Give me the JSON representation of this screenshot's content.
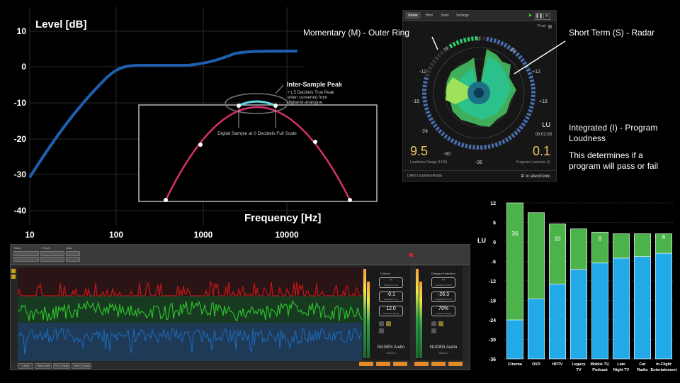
{
  "filter_chart": {
    "ylabel": "Level [dB]",
    "xlabel": "Frequency [Hz]",
    "yticks": [
      "10",
      "0",
      "-10",
      "-20",
      "-30",
      "-40"
    ],
    "xticks": [
      "10",
      "100",
      "1000",
      "10000"
    ],
    "isp_title": "Inter-Sample Peak",
    "isp_desc_1": "+1.5 Decibels True Peak",
    "isp_desc_2": "when converted from",
    "isp_desc_3": "digital to analogue.",
    "sample_label": "Digital Sample at 0 Decibels Full Scale",
    "curve_color": "#1f5fb0",
    "arc_color": "#d92f72",
    "peak_color": "#5fd8e6"
  },
  "radar": {
    "tabs": [
      "Radar",
      "Hmx",
      "Stats",
      "Settings"
    ],
    "peak_label": "Peak",
    "ticks": [
      "0",
      "+6",
      "+12",
      "+18",
      "-6",
      "-12",
      "-18",
      "-24",
      "-30",
      "-36"
    ],
    "lra_value": "9.5",
    "lra_label": "Loudness Range (LRA)",
    "lu_label": "LU",
    "time": "00:01:03",
    "program_value": "0.1",
    "program_label": "Program Loudness (I)",
    "product": "LM6n LoudnessRadar",
    "brand": "tc electronic",
    "value_color": "#e8c660"
  },
  "annotations": {
    "momentary": "Momentary (M) - Outer Ring",
    "short_term": "Short Term (S) - Radar",
    "integrated_1": "Integrated (I) - Program",
    "integrated_2": "Loudness",
    "determines_1": "This determines if a",
    "determines_2": "program will pass or fail"
  },
  "app": {
    "top_labels": [
      "Track",
      "Preset",
      "Data"
    ],
    "left_meter": {
      "title": "Custom",
      "box1_value": "--",
      "box1_caption": "Shortterm (LU)",
      "box2_value": "-0.1",
      "box2_caption": "Integrated (LU)",
      "box3_value": "12.0",
      "box3_caption": "Loudness Range",
      "brand": "NUGEN Audio",
      "product": "VisLM-H"
    },
    "right_meter": {
      "title": "Dialogue Detection",
      "box1_value": "--",
      "box1_caption": "Shortterm (LKFS)",
      "box2_value": "-26.3",
      "box2_caption": "Integrated (LKFS)",
      "box3_value": "79%",
      "box3_caption": "Loudness Range",
      "brand": "NUGEN Audio",
      "product": "VisLM-H"
    },
    "bottom_buttons": [
      "1 hour",
      "Time Code",
      "FR 2.5 secs",
      "Hold",
      "Zoom"
    ],
    "colors": {
      "red": "#c01818",
      "green": "#2bbf2b",
      "blue": "#1f6bbd"
    }
  },
  "chart_data": {
    "type": "bar",
    "categories": [
      "Cinema",
      "DVD",
      "HDTV",
      "Legacy TV",
      "Mobile TV, Podcast",
      "Late Night TV",
      "Car Radio",
      "In-Flight Entertainment"
    ],
    "category_lines": [
      [
        "Cinema"
      ],
      [
        "DVD"
      ],
      [
        "HDTV"
      ],
      [
        "Legacy",
        "TV"
      ],
      [
        "Mobile TV,",
        "Podcast"
      ],
      [
        "Late",
        "Night TV"
      ],
      [
        "Car",
        "Radio"
      ],
      [
        "In-Flight",
        "Entertainment"
      ]
    ],
    "series": [
      {
        "values_low": [
          -36,
          -36,
          -36,
          -36,
          -36,
          -36,
          -36,
          -36
        ],
        "values_high": [
          -24,
          -17.5,
          -13,
          -8.5,
          -6.5,
          -5,
          -4.5,
          -3.5
        ],
        "color": "#22a9e8"
      },
      {
        "values_low": [
          -24,
          -17.5,
          -13,
          -8.5,
          -6.5,
          -5,
          -4.5,
          -3.5
        ],
        "values_high": [
          12,
          9,
          5.5,
          4,
          3,
          2.5,
          2.5,
          2.5
        ],
        "color": "#4cb34a"
      }
    ],
    "bar_labels": [
      "36",
      "",
      "20",
      "",
      "8",
      "",
      "",
      "6"
    ],
    "ylabel": "LU",
    "ylim": [
      -36,
      12
    ],
    "yticks": [
      "12",
      "6",
      "0",
      "-6",
      "-12",
      "-18",
      "-24",
      "-30",
      "-36"
    ],
    "grid": true
  }
}
